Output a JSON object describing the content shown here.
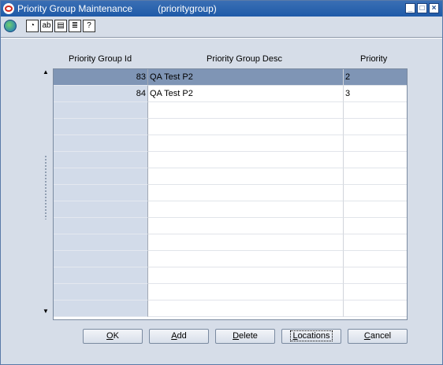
{
  "window": {
    "title": "Priority Group Maintenance",
    "module": "(prioritygroup)",
    "controls": [
      "minimize-icon",
      "maximize-icon",
      "close-icon"
    ]
  },
  "toolbar": {
    "icons": [
      "globe-icon",
      "help-icon",
      "spellcheck-icon",
      "notes-icon",
      "print-icon",
      "question-icon"
    ]
  },
  "grid": {
    "columns": [
      "Priority Group Id",
      "Priority Group Desc",
      "Priority"
    ],
    "rows": [
      {
        "id": "83",
        "desc": "QA Test P2",
        "priority": "2",
        "selected": true
      },
      {
        "id": "84",
        "desc": "QA Test P2",
        "priority": "3",
        "selected": false
      }
    ],
    "empty_rows": 13
  },
  "buttons": {
    "ok": {
      "mnemonic": "O",
      "rest": "K"
    },
    "add": {
      "mnemonic": "A",
      "rest": "dd"
    },
    "delete": {
      "mnemonic": "D",
      "rest": "elete"
    },
    "locations": {
      "mnemonic": "L",
      "rest": "ocations"
    },
    "cancel": {
      "mnemonic": "C",
      "rest": "ancel"
    }
  },
  "colors": {
    "titlebar": "#1f5aa8",
    "selected_row": "#7f95b5",
    "id_column": "#d2dbe9",
    "background": "#d6dde8"
  }
}
